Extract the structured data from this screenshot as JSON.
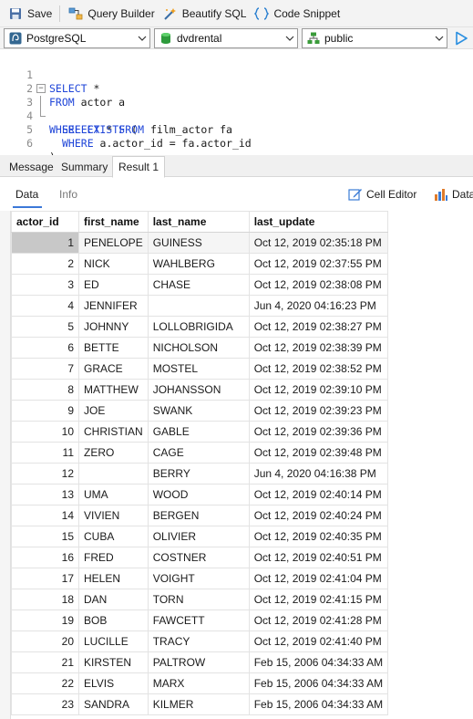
{
  "toolbar": {
    "save": "Save",
    "query_builder": "Query Builder",
    "beautify_sql": "Beautify SQL",
    "code_snippet": "Code Snippet"
  },
  "connection": {
    "server": "PostgreSQL",
    "database": "dvdrental",
    "schema": "public"
  },
  "editor": {
    "line_numbers": [
      "1",
      "2",
      "3",
      "4",
      "5",
      "6"
    ],
    "lines": [
      {
        "kw1": "SELECT",
        "rest": " *"
      },
      {
        "kw1": "FROM",
        "rest": " actor a"
      },
      {
        "kw1": "WHERE EXISTS",
        "rest": " ("
      },
      {
        "kw1": "SELECT",
        "mid": " * ",
        "kw2": "FROM",
        "rest": " film_actor fa"
      },
      {
        "kw1": "WHERE",
        "rest": " a.actor_id = fa.actor_id"
      },
      {
        "kw1": "",
        "rest": ")"
      }
    ]
  },
  "result_tabs": [
    "Message",
    "Summary",
    "Result 1"
  ],
  "subtabs": {
    "data": "Data",
    "info": "Info",
    "cell_editor": "Cell Editor",
    "data_truncated": "Data"
  },
  "table": {
    "columns": [
      "actor_id",
      "first_name",
      "last_name",
      "last_update"
    ],
    "rows": [
      [
        "1",
        "PENELOPE",
        "GUINESS",
        "Oct 12, 2019 02:35:18 PM"
      ],
      [
        "2",
        "NICK",
        "WAHLBERG",
        "Oct 12, 2019 02:37:55 PM"
      ],
      [
        "3",
        "ED",
        "CHASE",
        "Oct 12, 2019 02:38:08 PM"
      ],
      [
        "4",
        "JENNIFER",
        "",
        "Jun 4, 2020 04:16:23 PM"
      ],
      [
        "5",
        "JOHNNY",
        "LOLLOBRIGIDA",
        "Oct 12, 2019 02:38:27 PM"
      ],
      [
        "6",
        "BETTE",
        "NICHOLSON",
        "Oct 12, 2019 02:38:39 PM"
      ],
      [
        "7",
        "GRACE",
        "MOSTEL",
        "Oct 12, 2019 02:38:52 PM"
      ],
      [
        "8",
        "MATTHEW",
        "JOHANSSON",
        "Oct 12, 2019 02:39:10 PM"
      ],
      [
        "9",
        "JOE",
        "SWANK",
        "Oct 12, 2019 02:39:23 PM"
      ],
      [
        "10",
        "CHRISTIAN",
        "GABLE",
        "Oct 12, 2019 02:39:36 PM"
      ],
      [
        "11",
        "ZERO",
        "CAGE",
        "Oct 12, 2019 02:39:48 PM"
      ],
      [
        "12",
        "",
        "BERRY",
        "Jun 4, 2020 04:16:38 PM"
      ],
      [
        "13",
        "UMA",
        "WOOD",
        "Oct 12, 2019 02:40:14 PM"
      ],
      [
        "14",
        "VIVIEN",
        "BERGEN",
        "Oct 12, 2019 02:40:24 PM"
      ],
      [
        "15",
        "CUBA",
        "OLIVIER",
        "Oct 12, 2019 02:40:35 PM"
      ],
      [
        "16",
        "FRED",
        "COSTNER",
        "Oct 12, 2019 02:40:51 PM"
      ],
      [
        "17",
        "HELEN",
        "VOIGHT",
        "Oct 12, 2019 02:41:04 PM"
      ],
      [
        "18",
        "DAN",
        "TORN",
        "Oct 12, 2019 02:41:15 PM"
      ],
      [
        "19",
        "BOB",
        "FAWCETT",
        "Oct 12, 2019 02:41:28 PM"
      ],
      [
        "20",
        "LUCILLE",
        "TRACY",
        "Oct 12, 2019 02:41:40 PM"
      ],
      [
        "21",
        "KIRSTEN",
        "PALTROW",
        "Feb 15, 2006 04:34:33 AM"
      ],
      [
        "22",
        "ELVIS",
        "MARX",
        "Feb 15, 2006 04:34:33 AM"
      ],
      [
        "23",
        "SANDRA",
        "KILMER",
        "Feb 15, 2006 04:34:33 AM"
      ]
    ],
    "selected_row": 0
  },
  "colors": {
    "keyword": "#1f45d8",
    "accent": "#3b78d8",
    "run_arrow": "#2a8fe0"
  }
}
